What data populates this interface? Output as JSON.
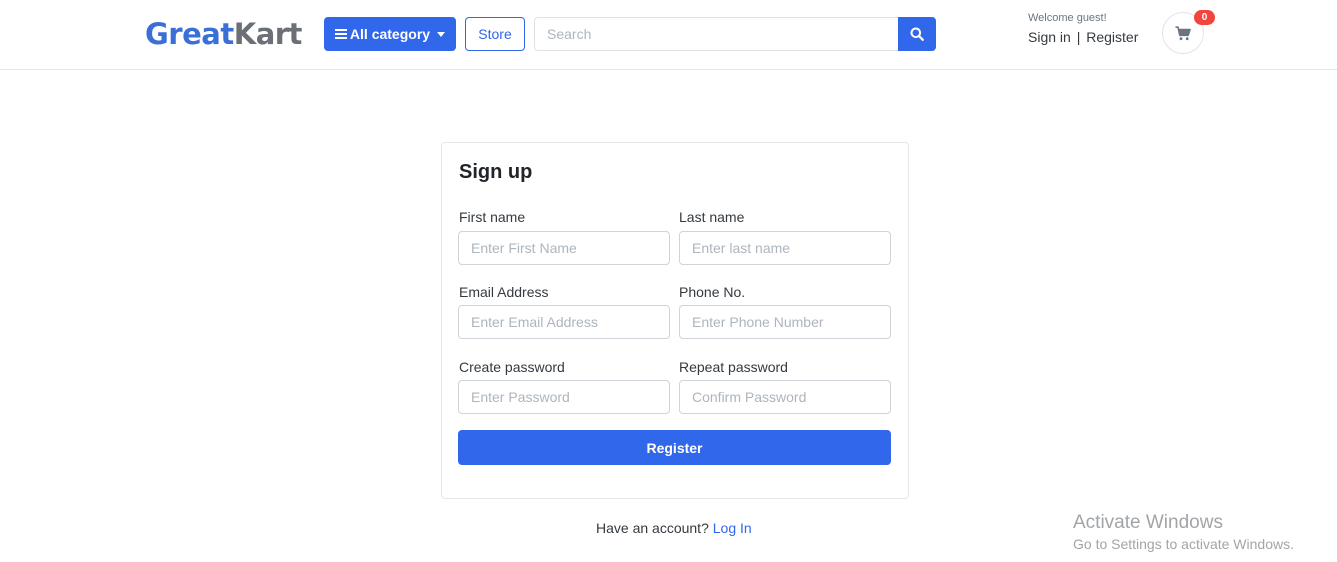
{
  "header": {
    "logo_part1": "Great",
    "logo_part2": "Kart",
    "all_category_label": "All category",
    "store_label": "Store",
    "search_placeholder": "Search",
    "welcome_text": "Welcome guest!",
    "signin_label": "Sign in",
    "separator": "|",
    "register_label": "Register",
    "cart_count": "0"
  },
  "signup": {
    "title": "Sign up",
    "fields": [
      {
        "label": "First name",
        "placeholder": "Enter First Name"
      },
      {
        "label": "Last name",
        "placeholder": "Enter last name"
      },
      {
        "label": "Email Address",
        "placeholder": "Enter Email Address"
      },
      {
        "label": "Phone No.",
        "placeholder": "Enter Phone Number"
      },
      {
        "label": "Create password",
        "placeholder": "Enter Password"
      },
      {
        "label": "Repeat password",
        "placeholder": "Confirm Password"
      }
    ],
    "submit_label": "Register"
  },
  "footer": {
    "have_account_text": "Have an account?",
    "login_link": "Log In"
  },
  "watermark": {
    "line1": "Activate Windows",
    "line2": "Go to Settings to activate Windows."
  },
  "colors": {
    "primary": "#3167eb",
    "badge": "#f1453d",
    "logo_blue": "#3b6fd8",
    "logo_gray": "#6b6f76"
  },
  "icons": {
    "menu": "bars-icon",
    "dropdown": "caret-down-icon",
    "search": "search-icon",
    "cart": "shopping-cart-icon"
  }
}
